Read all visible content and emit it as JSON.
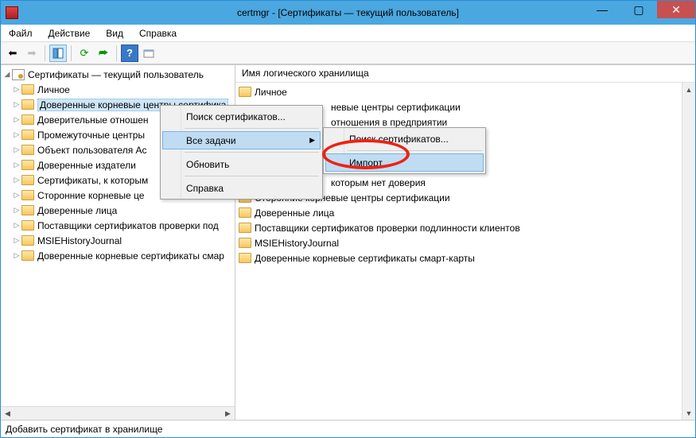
{
  "window": {
    "title": "certmgr - [Сертификаты — текущий пользователь]"
  },
  "menu": {
    "file": "Файл",
    "action": "Действие",
    "view": "Вид",
    "help": "Справка"
  },
  "tree": {
    "root": "Сертификаты — текущий пользователь",
    "items": [
      "Личное",
      "Доверенные корневые центры сертифика",
      "Доверительные отношен",
      "Промежуточные центры",
      "Объект пользователя Ac",
      "Доверенные издатели",
      "Сертификаты, к которым",
      "Сторонние корневые це",
      "Доверенные лица",
      "Поставщики сертификатов проверки под",
      "MSIEHistoryJournal",
      "Доверенные корневые сертификаты смар"
    ]
  },
  "right": {
    "header": "Имя логического хранилища",
    "items": [
      "Личное",
      "невые центры сертификации",
      "отношения в предприятии",
      "",
      "",
      "",
      "которым нет доверия",
      "Сторонние корневые центры сертификации",
      "Доверенные лица",
      "Поставщики сертификатов проверки подлинности клиентов",
      "MSIEHistoryJournal",
      "Доверенные корневые сертификаты смарт-карты"
    ]
  },
  "contextMenu1": {
    "findCerts": "Поиск сертификатов...",
    "allTasks": "Все задачи",
    "refresh": "Обновить",
    "help": "Справка"
  },
  "contextMenu2": {
    "findCerts": "Поиск сертификатов...",
    "import": "Импорт..."
  },
  "status": "Добавить сертификат в хранилище"
}
